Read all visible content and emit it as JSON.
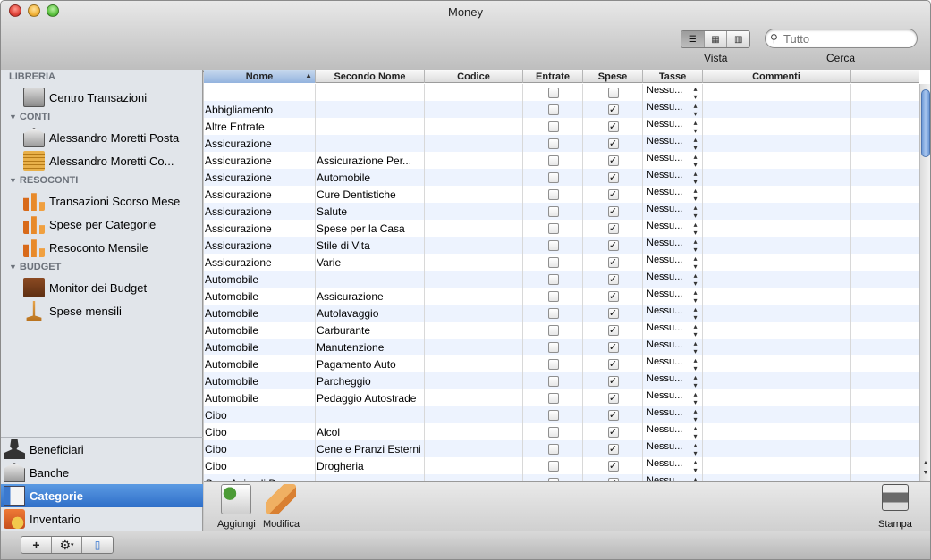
{
  "window": {
    "title": "Money"
  },
  "toolbar": {
    "view_label": "Vista",
    "search_label": "Cerca",
    "search_value": "Tutto",
    "view_modes": [
      "list-icon",
      "grid-icon",
      "columns-icon"
    ]
  },
  "sidebar": {
    "sections": [
      {
        "header": "LIBRERIA",
        "items": [
          {
            "label": "Centro Transazioni",
            "icon": "safe-icon"
          }
        ]
      },
      {
        "header": "CONTI",
        "items": [
          {
            "label": "Alessandro Moretti Posta",
            "icon": "bank-icon"
          },
          {
            "label": "Alessandro Moretti Co...",
            "icon": "coins-icon"
          }
        ]
      },
      {
        "header": "RESOCONTI",
        "items": [
          {
            "label": "Transazioni Scorso Mese",
            "icon": "bar-chart-icon"
          },
          {
            "label": "Spese per Categorie",
            "icon": "bar-chart-icon"
          },
          {
            "label": "Resoconto Mensile",
            "icon": "bar-chart-icon"
          }
        ]
      },
      {
        "header": "BUDGET",
        "items": [
          {
            "label": "Monitor dei Budget",
            "icon": "wallet-icon"
          },
          {
            "label": "Spese mensili",
            "icon": "scale-icon"
          }
        ]
      }
    ],
    "lower": [
      {
        "label": "Beneficiari",
        "icon": "person-icon"
      },
      {
        "label": "Banche",
        "icon": "bank-icon"
      },
      {
        "label": "Categorie",
        "icon": "book-icon",
        "selected": true
      },
      {
        "label": "Inventario",
        "icon": "inventory-icon"
      }
    ]
  },
  "table": {
    "columns": [
      "Nome",
      "Secondo Nome",
      "Codice",
      "Entrate",
      "Spese",
      "Tasse",
      "Commenti"
    ],
    "sorted_column": "Nome",
    "tax_value": "Nessu...",
    "rows": [
      {
        "nome": "",
        "secondo": "",
        "entrate": false,
        "spese": false
      },
      {
        "nome": "Abbigliamento",
        "secondo": "",
        "entrate": false,
        "spese": true
      },
      {
        "nome": "Altre Entrate",
        "secondo": "",
        "entrate": false,
        "spese": true
      },
      {
        "nome": "Assicurazione",
        "secondo": "",
        "entrate": false,
        "spese": true
      },
      {
        "nome": "Assicurazione",
        "secondo": "Assicurazione Per...",
        "entrate": false,
        "spese": true
      },
      {
        "nome": "Assicurazione",
        "secondo": "Automobile",
        "entrate": false,
        "spese": true
      },
      {
        "nome": "Assicurazione",
        "secondo": "Cure Dentistiche",
        "entrate": false,
        "spese": true
      },
      {
        "nome": "Assicurazione",
        "secondo": "Salute",
        "entrate": false,
        "spese": true
      },
      {
        "nome": "Assicurazione",
        "secondo": "Spese per la Casa",
        "entrate": false,
        "spese": true
      },
      {
        "nome": "Assicurazione",
        "secondo": "Stile di Vita",
        "entrate": false,
        "spese": true
      },
      {
        "nome": "Assicurazione",
        "secondo": "Varie",
        "entrate": false,
        "spese": true
      },
      {
        "nome": "Automobile",
        "secondo": "",
        "entrate": false,
        "spese": true
      },
      {
        "nome": "Automobile",
        "secondo": "Assicurazione",
        "entrate": false,
        "spese": true
      },
      {
        "nome": "Automobile",
        "secondo": "Autolavaggio",
        "entrate": false,
        "spese": true
      },
      {
        "nome": "Automobile",
        "secondo": "Carburante",
        "entrate": false,
        "spese": true
      },
      {
        "nome": "Automobile",
        "secondo": "Manutenzione",
        "entrate": false,
        "spese": true
      },
      {
        "nome": "Automobile",
        "secondo": "Pagamento Auto",
        "entrate": false,
        "spese": true
      },
      {
        "nome": "Automobile",
        "secondo": "Parcheggio",
        "entrate": false,
        "spese": true
      },
      {
        "nome": "Automobile",
        "secondo": "Pedaggio Autostrade",
        "entrate": false,
        "spese": true
      },
      {
        "nome": "Cibo",
        "secondo": "",
        "entrate": false,
        "spese": true
      },
      {
        "nome": "Cibo",
        "secondo": "Alcol",
        "entrate": false,
        "spese": true
      },
      {
        "nome": "Cibo",
        "secondo": "Cene e Pranzi Esterni",
        "entrate": false,
        "spese": true
      },
      {
        "nome": "Cibo",
        "secondo": "Drogheria",
        "entrate": false,
        "spese": true
      },
      {
        "nome": "Cura Animali Dom...",
        "secondo": "",
        "entrate": false,
        "spese": true
      }
    ]
  },
  "actions": {
    "add_label": "Aggiungi",
    "edit_label": "Modifica",
    "print_label": "Stampa"
  },
  "bottom": {
    "add": "+",
    "gear": "⚙",
    "panel": "▯"
  }
}
